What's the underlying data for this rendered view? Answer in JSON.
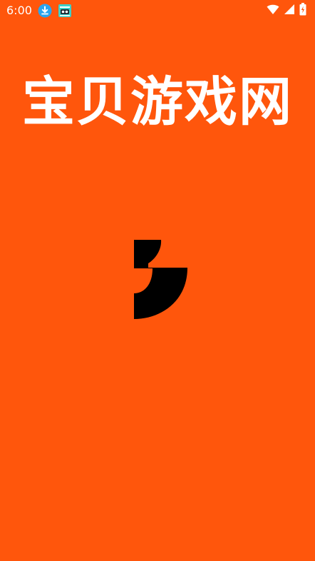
{
  "status_bar": {
    "time": "6:00",
    "notification_icons": [
      "download-icon",
      "app-notification-icon"
    ],
    "system_icons": [
      "wifi-icon",
      "cellular-signal-icon",
      "battery-charging-icon"
    ]
  },
  "splash": {
    "title": "宝贝游戏网",
    "logo": "logo-mark"
  },
  "colors": {
    "background": "#ff560c",
    "title": "#ffffff",
    "logo": "#000000",
    "download_badge": "#2aa5ee",
    "app_badge": "#3ccfc8"
  }
}
